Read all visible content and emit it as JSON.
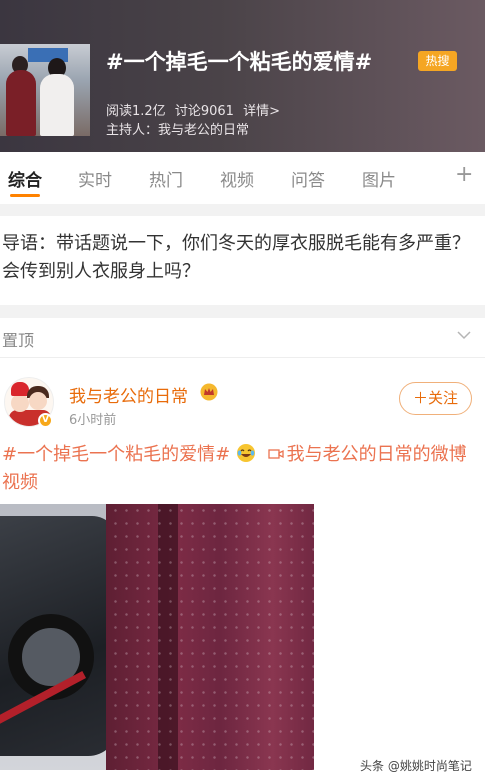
{
  "header": {
    "topic_title": "#一个掉毛一个粘毛的爱情#",
    "hot_badge": "热搜",
    "stats": {
      "reads": "阅读1.2亿",
      "discussions": "讨论9061",
      "details": "详情>"
    },
    "host": "主持人：我与老公的日常"
  },
  "tabs": [
    {
      "label": "综合",
      "active": true
    },
    {
      "label": "实时",
      "active": false
    },
    {
      "label": "热门",
      "active": false
    },
    {
      "label": "视频",
      "active": false
    },
    {
      "label": "问答",
      "active": false
    },
    {
      "label": "图片",
      "active": false
    }
  ],
  "tab_add_symbol": "+",
  "intro": {
    "text": "导语：带话题说一下，你们冬天的厚衣服脱毛能有多严重？会传到别人衣服身上吗？"
  },
  "pinned": {
    "label": "置顶"
  },
  "post": {
    "username": "我与老公的日常",
    "verify_mark": "V",
    "time": "6小时前",
    "follow_label": "＋关注",
    "hashtag": "#一个掉毛一个粘毛的爱情#",
    "video_link": "我与老公的日常的微博视频"
  },
  "watermark": "头条 @姚姚时尚笔记",
  "colors": {
    "accent_orange": "#ff8200",
    "username_orange": "#e86b0a",
    "hashtag_color": "#eb7350",
    "hot_badge": "#f5a623"
  },
  "icons": {
    "tab_add": "plus-icon",
    "pinned_toggle": "chevron-down-icon",
    "crown": "crown-icon",
    "emoji": "laughing-tears-emoji-icon",
    "video": "video-camera-icon"
  }
}
